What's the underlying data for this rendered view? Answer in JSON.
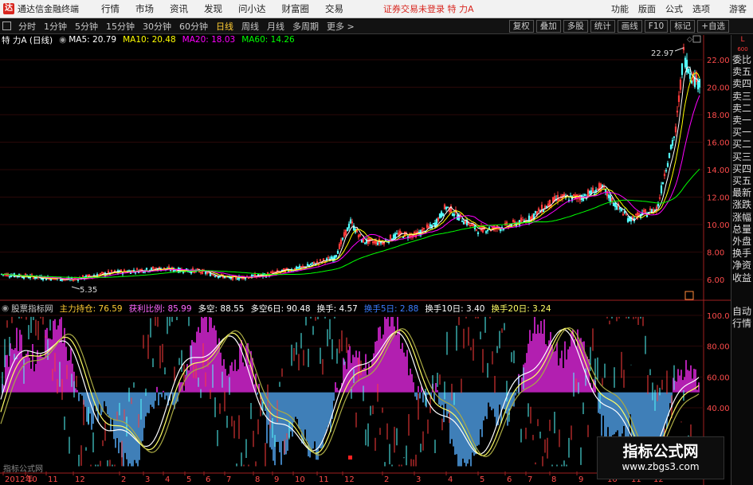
{
  "app": {
    "title": "通达信金融终端",
    "logo_glyph": "达"
  },
  "menu": [
    "行情",
    "市场",
    "资讯",
    "发现",
    "问小达",
    "财富圈",
    "交易"
  ],
  "alert": "证券交易未登录 特 力A",
  "top_right": [
    "功能",
    "版面",
    "公式",
    "选项",
    "游客"
  ],
  "periods": [
    "分时",
    "1分钟",
    "5分钟",
    "15分钟",
    "30分钟",
    "60分钟",
    "日线",
    "周线",
    "月线",
    "多周期",
    "更多 >"
  ],
  "active_period": "日线",
  "tools": [
    "复权",
    "叠加",
    "多股",
    "统计",
    "画线",
    "F10",
    "标记",
    "+自选"
  ],
  "main_legend": {
    "stock": "特 力A (日线)",
    "ma5": "MA5: 20.79",
    "ma10": "MA10: 20.48",
    "ma20": "MA20: 18.03",
    "ma60": "MA60: 14.26"
  },
  "ind_legend": {
    "name": "股票指标网",
    "a": "主力持仓: 76.59",
    "b": "获利比例: 85.99",
    "c": "多空: 88.55",
    "d": "多空6日: 90.48",
    "e": "换手: 4.57",
    "f": "换手5日: 2.88",
    "g": "换手10日: 3.40",
    "h": "换手20日: 3.24"
  },
  "price_labels": {
    "high": "22.97",
    "low": "5.35"
  },
  "price_ticks": [
    "22.00",
    "20.00",
    "18.00",
    "16.00",
    "14.00",
    "12.00",
    "10.00",
    "8.00",
    "6.00"
  ],
  "ind_ticks": [
    "100.0",
    "80.00",
    "60.00",
    "40.00"
  ],
  "x_labels": [
    "2012年",
    "10",
    "11",
    "12",
    "2",
    "3",
    "4",
    "5",
    "6",
    "7",
    "8",
    "9",
    "10",
    "11",
    "12",
    "2",
    "3",
    "4",
    "5",
    "6",
    "7",
    "8",
    "9",
    "10",
    "11",
    "12"
  ],
  "bottom_caption": "指标公式网",
  "side_tabs": [
    "委比",
    "卖五",
    "卖四",
    "卖三",
    "卖二",
    "卖一",
    "买一",
    "买二",
    "买三",
    "买四",
    "买五",
    "最新",
    "涨跌",
    "涨幅",
    "总量",
    "外盘",
    "换手",
    "净资",
    "收益"
  ],
  "side_bottom": [
    "自动",
    "行情"
  ],
  "side_flag": "L",
  "side_flag_sub": "600",
  "watermark": {
    "title": "指标公式网",
    "url": "www.zbgs3.com"
  },
  "colors": {
    "ma5": "#ffffff",
    "ma10": "#ffff00",
    "ma20": "#ff00ff",
    "ma60": "#00ff00",
    "up": "#ff3b3b",
    "down": "#54ffff",
    "magenta": "#b21fb0",
    "blue": "#3f7fb8"
  }
}
